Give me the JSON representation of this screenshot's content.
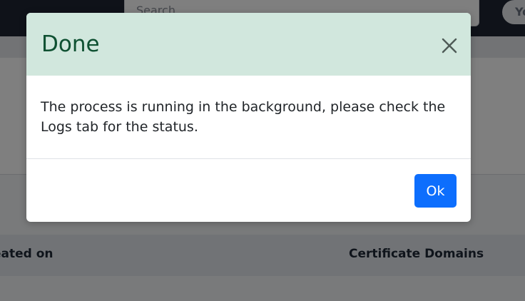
{
  "background": {
    "search": {
      "placeholder": "Search"
    },
    "user_initials": "Yo",
    "table": {
      "headers": [
        "eated on",
        "Certificate Domains"
      ]
    }
  },
  "modal": {
    "title": "Done",
    "message": "The process is running in the background, please check the Logs tab for the status.",
    "ok_label": "Ok",
    "close_icon": "close-icon"
  },
  "colors": {
    "header_bg": "#d1e7dd",
    "title_text": "#0f5132",
    "primary_button": "#0d6efd",
    "topbar": "#1e2532"
  }
}
